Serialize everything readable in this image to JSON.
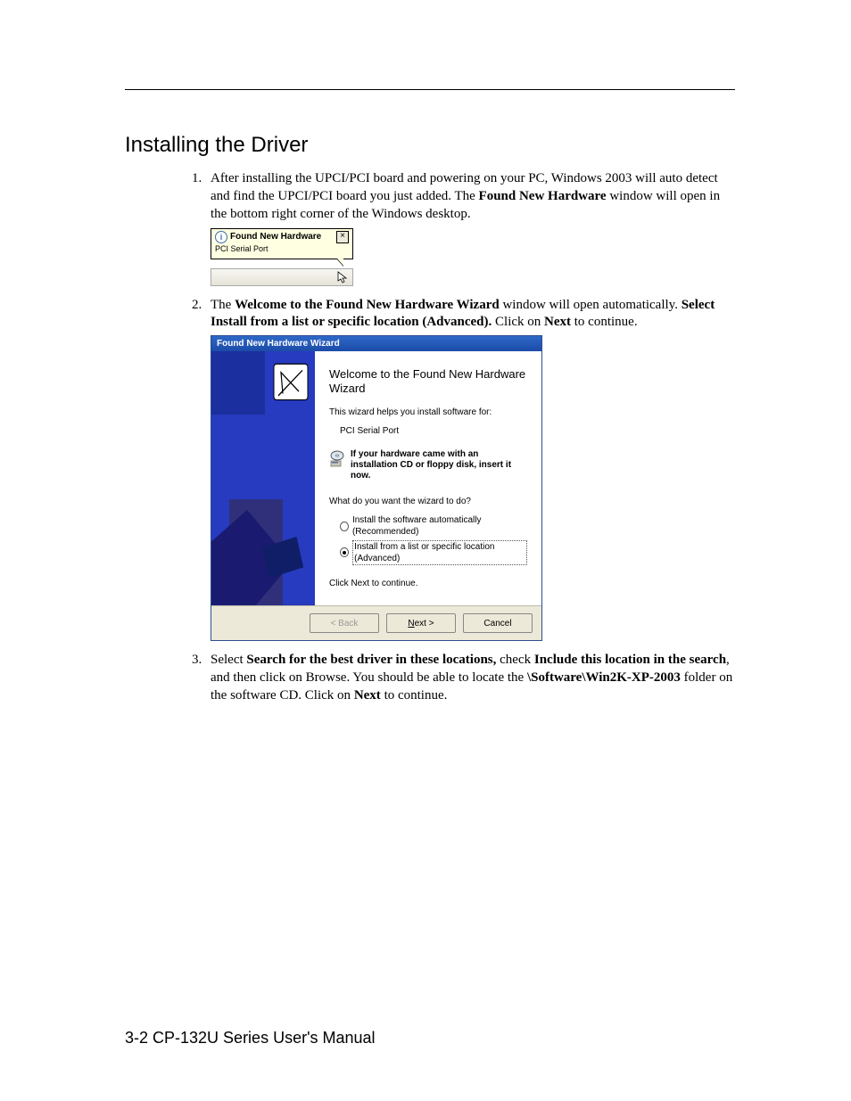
{
  "section_title": "Installing the Driver",
  "footer": "3-2   CP-132U Series User's Manual",
  "steps": {
    "s1": {
      "text_a": "After installing the UPCI/PCI board and powering on your PC, Windows 2003 will auto detect and find the UPCI/PCI board you just added. The ",
      "bold_a": "Found New Hardware",
      "text_b": " window will open in the bottom right corner of the Windows desktop."
    },
    "s2": {
      "text_a": "The ",
      "bold_a": "Welcome to the Found New Hardware Wizard",
      "text_b": " window will open automatically. ",
      "bold_b": "Select Install from a list or specific location (Advanced).",
      "text_c": " Click on ",
      "bold_c": "Next",
      "text_d": " to continue."
    },
    "s3": {
      "text_a": "Select ",
      "bold_a": "Search for the best driver in these locations,",
      "text_b": " check ",
      "bold_b": "Include this location in the search",
      "text_c": ", and then click on Browse. You should be able to locate the ",
      "bold_c": "\\Software\\Win2K-XP-2003",
      "text_d": " folder on the software CD. Click on ",
      "bold_d": "Next",
      "text_e": " to continue."
    }
  },
  "balloon": {
    "title": "Found New Hardware",
    "close": "×",
    "body": "PCI Serial Port"
  },
  "wizard": {
    "titlebar": "Found New Hardware Wizard",
    "title": "Welcome to the Found New Hardware Wizard",
    "help_line": "This wizard helps you install software for:",
    "device": "PCI Serial Port",
    "media_note": "If your hardware came with an installation CD or floppy disk, insert it now.",
    "question": "What do you want the wizard to do?",
    "option_auto": "Install the software automatically (Recommended)",
    "option_list": "Install from a list or specific location (Advanced)",
    "click_next": "Click Next to continue.",
    "btn_back": "< Back",
    "btn_next_pre": "N",
    "btn_next_post": "ext >",
    "btn_cancel": "Cancel"
  }
}
